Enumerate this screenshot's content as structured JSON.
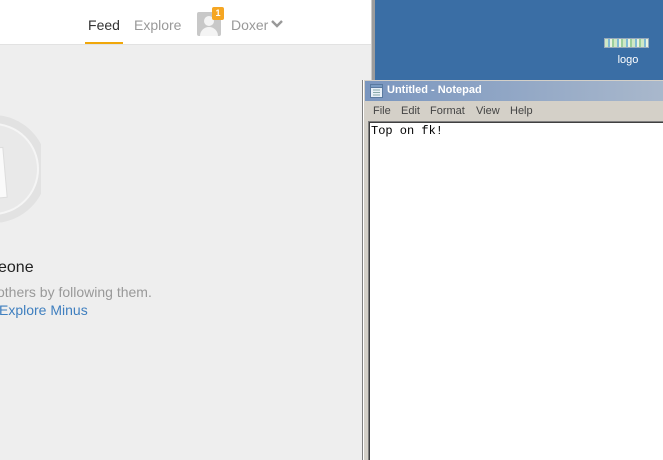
{
  "browser": {
    "nav": {
      "feed": "Feed",
      "explore": "Explore"
    },
    "user": {
      "notification_count": "1",
      "name": "Doxer"
    },
    "empty_state": {
      "title": "eone",
      "subtitle": "others by following them.",
      "link": "Explore Minus"
    },
    "accent_color": "#f0a70a"
  },
  "desktop": {
    "logo_label": "logo"
  },
  "notepad": {
    "title": "Untitled - Notepad",
    "menu": [
      "File",
      "Edit",
      "Format",
      "View",
      "Help"
    ],
    "content": "Top on fk!"
  }
}
